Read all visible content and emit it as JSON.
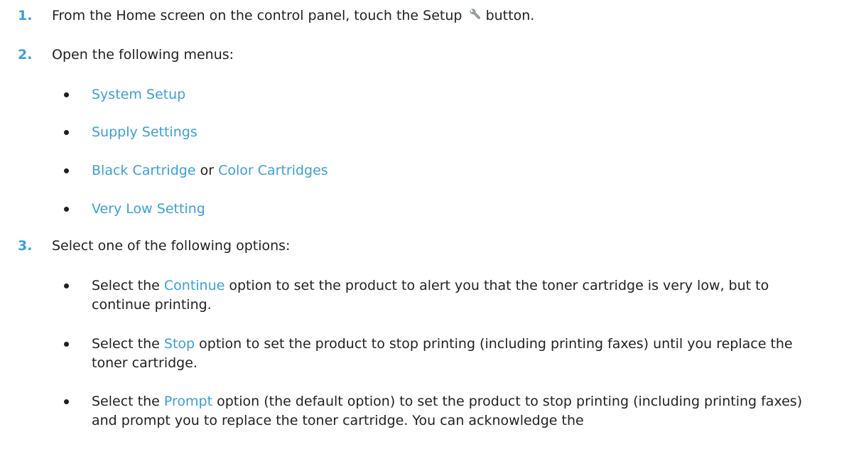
{
  "steps": {
    "s1": {
      "num": "1.",
      "text_before": "From the Home screen on the control panel, touch the Setup",
      "icon": "wrench-icon",
      "text_after": "button."
    },
    "s2": {
      "num": "2.",
      "text": "Open the following menus:",
      "menus": [
        {
          "label": "System Setup"
        },
        {
          "label": "Supply Settings"
        },
        {
          "label_a": "Black Cartridge",
          "conj": "or",
          "label_b": "Color Cartridges"
        },
        {
          "label": "Very Low Setting"
        }
      ]
    },
    "s3": {
      "num": "3.",
      "text": "Select one of the following options:",
      "options": [
        {
          "pre": "Select the",
          "option": "Continue",
          "post": "option to set the product to alert you that the toner cartridge is very low, but to continue printing."
        },
        {
          "pre": "Select the",
          "option": "Stop",
          "post": "option to set the product to stop printing (including printing faxes) until you replace the toner cartridge."
        },
        {
          "pre": "Select the",
          "option": "Prompt",
          "post": "option (the default option) to set the product to stop printing (including printing faxes) and prompt you to replace the toner cartridge. You can acknowledge the"
        }
      ]
    }
  },
  "colors": {
    "accent": "#3b9fd8",
    "text": "#231f20"
  }
}
